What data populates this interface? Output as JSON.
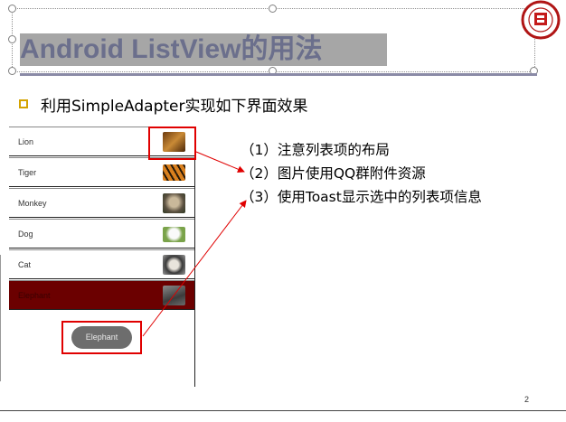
{
  "slide": {
    "title": "Android ListView的用法",
    "bullet": "利用SimpleAdapter实现如下界面效果",
    "page_number": "2"
  },
  "app_list": {
    "items": [
      {
        "label": "Lion",
        "icon": "lion-photo-icon",
        "selected": false
      },
      {
        "label": "Tiger",
        "icon": "tiger-photo-icon",
        "selected": false
      },
      {
        "label": "Monkey",
        "icon": "monkey-photo-icon",
        "selected": false
      },
      {
        "label": "Dog",
        "icon": "dog-photo-icon",
        "selected": false
      },
      {
        "label": "Cat",
        "icon": "cat-photo-icon",
        "selected": false
      },
      {
        "label": "Elephant",
        "icon": "elephant-photo-icon",
        "selected": true
      }
    ],
    "selected_color": "#6b0000",
    "toast": "Elephant"
  },
  "notes": [
    "（1）注意列表项的布局",
    "（2）图片使用QQ群附件资源",
    "（3）使用Toast显示选中的列表项信息"
  ],
  "colors": {
    "highlight": "#e00000",
    "title_text": "#6b6f8c",
    "title_bg": "#a6a6a6",
    "bullet": "#d4a300"
  }
}
